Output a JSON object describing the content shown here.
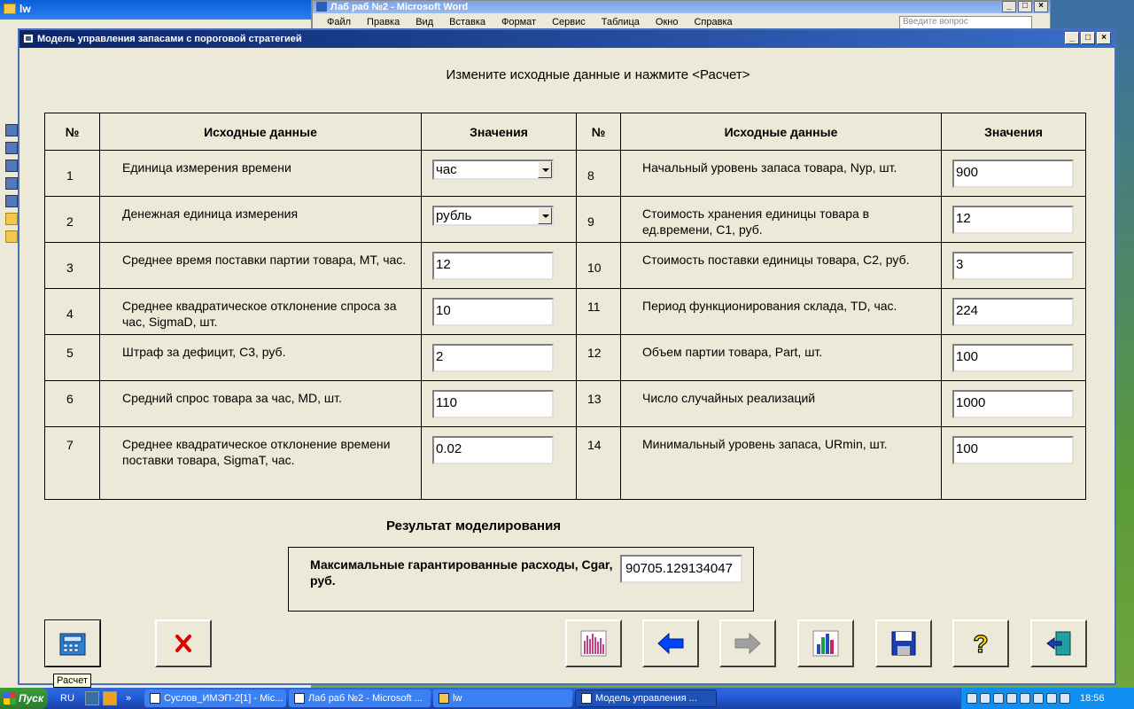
{
  "dialog": {
    "title": "Модель управления запасами с пороговой стратегией",
    "heading": "Измените исходные данные и нажмите <Расчет>",
    "win_buttons": {
      "minimize": "_",
      "maximize": "□",
      "close": "×"
    }
  },
  "table": {
    "headers": {
      "num": "№",
      "name": "Исходные данные",
      "value": "Значения"
    },
    "left": [
      {
        "num": "1",
        "name": "Единица измерения времени",
        "value": "час",
        "kind": "combo"
      },
      {
        "num": "2",
        "name": "Денежная единица измерения",
        "value": "рубль",
        "kind": "combo"
      },
      {
        "num": "3",
        "name": "Среднее время поставки партии товара, MT, час.",
        "value": "12",
        "kind": "text"
      },
      {
        "num": "4",
        "name": "Среднее квадратическое отклонение спроса за час, SigmaD, шт.",
        "value": "10",
        "kind": "text"
      },
      {
        "num": "5",
        "name": "Штраф за дефицит, C3, руб.",
        "value": "2",
        "kind": "text"
      },
      {
        "num": "6",
        "name": "Средний спрос товара за час, MD, шт.",
        "value": "110",
        "kind": "text"
      },
      {
        "num": "7",
        "name": "Среднее квадратическое отклонение времени поставки товара, SigmaT, час.",
        "value": "0.02",
        "kind": "text"
      }
    ],
    "right": [
      {
        "num": "8",
        "name": "Начальный уровень запаса товара, Nyp, шт.",
        "value": "900"
      },
      {
        "num": "9",
        "name": "Стоимость хранения единицы товара в ед.времени, C1, руб.",
        "value": "12"
      },
      {
        "num": "10",
        "name": "Стоимость поставки единицы товара, C2, руб.",
        "value": "3"
      },
      {
        "num": "11",
        "name": "Период функционирования склада, TD, час.",
        "value": "224"
      },
      {
        "num": "12",
        "name": "Объем партии товара, Part, шт.",
        "value": "100"
      },
      {
        "num": "13",
        "name": "Число случайных реализаций",
        "value": "1000"
      },
      {
        "num": "14",
        "name": "Минимальный уровень запаса, URmin, шт.",
        "value": "100"
      }
    ]
  },
  "result": {
    "title": "Результат моделирования",
    "label": "Максимальные гарантированные расходы, Cgar, руб.",
    "value": "90705.129134047"
  },
  "toolbar": {
    "tooltip": "Расчет",
    "buttons": [
      "calculator-icon",
      "cancel-x-icon",
      "histogram-icon",
      "arrow-left-icon",
      "arrow-right-icon",
      "bar-chart-icon",
      "floppy-save-icon",
      "help-question-icon",
      "exit-door-icon"
    ]
  },
  "background": {
    "explorer_title": "lw",
    "word_title": "Лаб раб №2 - Microsoft Word",
    "word_menu": [
      "Файл",
      "Правка",
      "Вид",
      "Вставка",
      "Формат",
      "Сервис",
      "Таблица",
      "Окно",
      "Справка"
    ],
    "word_ask_placeholder": "Введите вопрос"
  },
  "taskbar": {
    "start": "Пуск",
    "lang": "RU",
    "more": "»",
    "tasks": [
      {
        "label": "Суслов_ИМЭП-2[1] - Mic...",
        "active": false
      },
      {
        "label": "Лаб раб №2 - Microsoft ...",
        "active": false
      },
      {
        "label": "lw",
        "active": false
      },
      {
        "label": "Модель управления ...",
        "active": true
      }
    ],
    "time": "18:56"
  },
  "colors": {
    "accent": "#0a246a",
    "face": "#ece9d8",
    "cancel_red": "#e00000",
    "arrow_blue": "#0044ff"
  }
}
